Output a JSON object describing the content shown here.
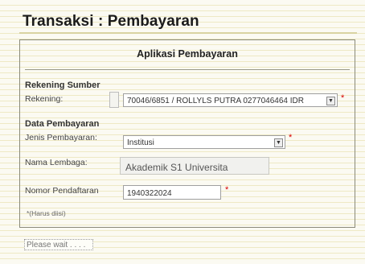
{
  "page": {
    "title": "Transaksi : Pembayaran"
  },
  "form": {
    "header": "Aplikasi Pembayaran",
    "sections": {
      "source": "Rekening Sumber",
      "payment": "Data Pembayaran"
    },
    "fields": {
      "rekening": {
        "label": "Rekening:",
        "value": "70046/6851 / ROLLYLS PUTRA   0277046464   IDR"
      },
      "jenis": {
        "label": "Jenis Pembayaran:",
        "value": "Institusi"
      },
      "lembaga": {
        "label": "Nama Lembaga:",
        "value": "Akademik  S1 Universita"
      },
      "pendaftaran": {
        "label": "Nomor Pendaftaran",
        "value": "1940322024"
      }
    },
    "required_marker": "*",
    "note": "*(Harus diisi)"
  },
  "status": {
    "text": "Please wait . . . ."
  },
  "icons": {
    "dropdown": "chevron-down-icon"
  },
  "colors": {
    "required": "#d80000",
    "background": "#fbfaf2"
  }
}
